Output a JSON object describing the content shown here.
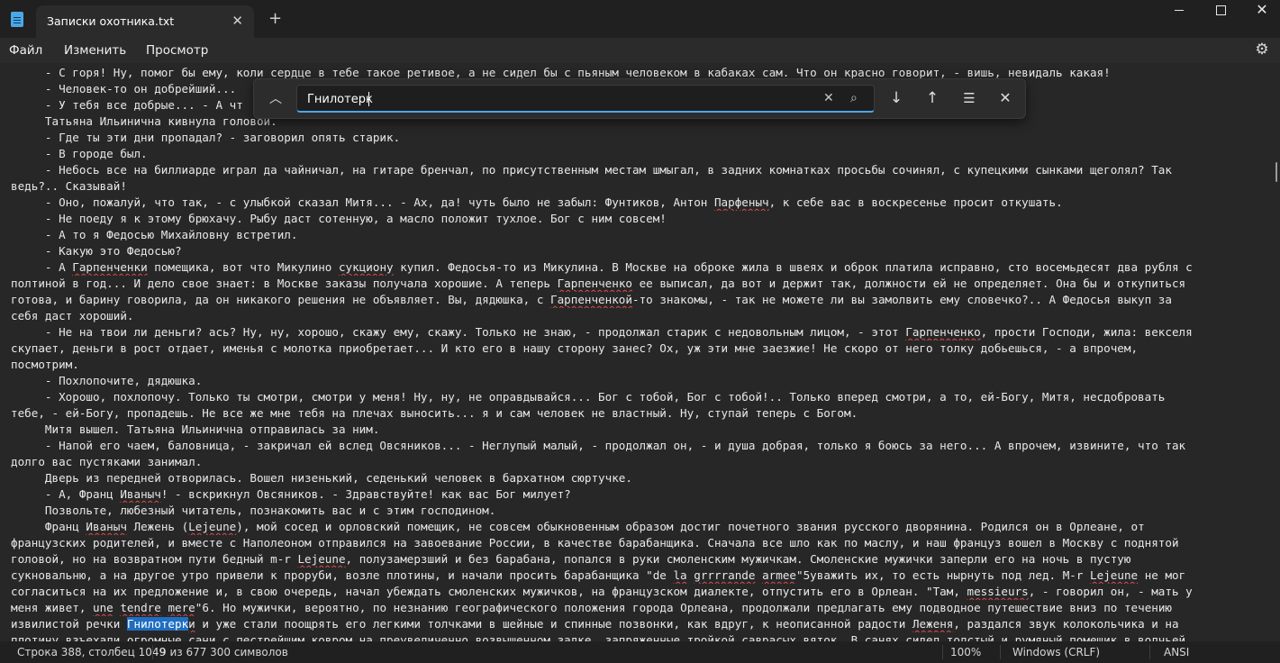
{
  "window": {
    "tab_title": "Записки охотника.txt",
    "tab_close_glyph": "✕",
    "new_tab_glyph": "+",
    "minimize_glyph": "",
    "maximize_glyph": "",
    "close_glyph": "✕"
  },
  "menu": {
    "file": "Файл",
    "edit": "Изменить",
    "view": "Просмотр",
    "settings_icon": "gear-icon"
  },
  "find": {
    "query": "Гнилотерк",
    "toggle_icon": "chevron-up-icon",
    "clear_icon": "close-icon",
    "search_icon": "search-icon",
    "next_icon": "arrow-down-icon",
    "prev_icon": "arrow-up-icon",
    "options_icon": "sliders-icon",
    "close_icon": "close-icon"
  },
  "editor": {
    "lines": [
      [
        {
          "t": "     - С горя! Ну, помог бы ему, коли сердце в тебе такое ретивое, а не сидел бы с пьяным человеком в кабаках сам. Что он красно говорит, - вишь, невидаль какая!"
        }
      ],
      [
        {
          "t": "     - Человек-то он добрейший..."
        }
      ],
      [
        {
          "t": "     - У тебя все добрые... - А чт"
        }
      ],
      [
        {
          "t": "     Татьяна Ильинична кивнула головой."
        }
      ],
      [
        {
          "t": "     - Где ты эти дни пропадал? - заговорил опять старик."
        }
      ],
      [
        {
          "t": "     - В городе был."
        }
      ],
      [
        {
          "t": "     - Небось все на биллиарде играл да чайничал, на гитаре бренчал, по присутственным местам шмыгал, в задних комнатках просьбы сочинял, с купецкими сынками щеголял? Так"
        }
      ],
      [
        {
          "t": "ведь?.. Сказывай!"
        }
      ],
      [
        {
          "t": "     - Оно, пожалуй, что так, - с улыбкой сказал Митя... - Ах, да! чуть было не забыл: Фунтиков, Антон "
        },
        {
          "t": "Парфеныч",
          "s": 1
        },
        {
          "t": ", к себе вас в воскресенье просит откушать."
        }
      ],
      [
        {
          "t": "     - Не поеду я к этому брюхачу. Рыбу даст сотенную, а масло положит тухлое. Бог с ним совсем!"
        }
      ],
      [
        {
          "t": "     - А то я Федосью Михайловну встретил."
        }
      ],
      [
        {
          "t": "     - Какую это Федосью?"
        }
      ],
      [
        {
          "t": "     - А "
        },
        {
          "t": "Гарпенченки",
          "s": 1
        },
        {
          "t": " помещика, вот что Микулино "
        },
        {
          "t": "сукциону",
          "s": 1
        },
        {
          "t": " купил. Федосья-то из Микулина. В Москве на оброке жила в швеях и оброк платила исправно, сто восемьдесят два рубля с"
        }
      ],
      [
        {
          "t": "полтиной в год... И дело свое знает: в Москве заказы получала хорошие. А теперь "
        },
        {
          "t": "Гарпенченко",
          "s": 1
        },
        {
          "t": " ее выписал, да вот и держит так, должности ей не определяет. Она бы и откупиться"
        }
      ],
      [
        {
          "t": "готова, и барину говорила, да он никакого решения не объявляет. Вы, дядюшка, с "
        },
        {
          "t": "Гарпенченкой",
          "s": 1
        },
        {
          "t": "-то знакомы, - так не можете ли вы замолвить ему словечко?.. А Федосья выкуп за"
        }
      ],
      [
        {
          "t": "себя даст хороший."
        }
      ],
      [
        {
          "t": "     - Не на твои ли деньги? ась? Ну, ну, хорошо, скажу ему, скажу. Только не знаю, - продолжал старик с недовольным лицом, - этот "
        },
        {
          "t": "Гарпенченко",
          "s": 1
        },
        {
          "t": ", прости Господи, жила: векселя"
        }
      ],
      [
        {
          "t": "скупает, деньги в рост отдает, именья с молотка приобретает... И кто его в нашу сторону занес? Ох, уж эти мне заезжие! Не скоро от него толку добьешься, - а впрочем,"
        }
      ],
      [
        {
          "t": "посмотрим."
        }
      ],
      [
        {
          "t": "     - Похлопочите, дядюшка."
        }
      ],
      [
        {
          "t": "     - Хорошо, похлопочу. Только ты смотри, смотри у меня! Ну, ну, не оправдывайся... Бог с тобой, Бог с тобой!.. Только вперед смотри, а то, ей-Богу, Митя, несдобровать"
        }
      ],
      [
        {
          "t": "тебе, - ей-Богу, пропадешь. Не все же мне тебя на плечах выносить... я и сам человек не властный. Ну, ступай теперь с Богом."
        }
      ],
      [
        {
          "t": "     Митя вышел. Татьяна Ильинична отправилась за ним."
        }
      ],
      [
        {
          "t": "     - Напой его чаем, баловница, - закричал ей вслед Овсяников... - Неглупый малый, - продолжал он, - и душа добрая, только я боюсь за него... А впрочем, извините, что так"
        }
      ],
      [
        {
          "t": "долго вас пустяками занимал."
        }
      ],
      [
        {
          "t": "     Дверь из передней отворилась. Вошел низенький, седенький человек в бархатном сюртучке."
        }
      ],
      [
        {
          "t": "     - А, Франц "
        },
        {
          "t": "Иваныч",
          "s": 1
        },
        {
          "t": "! - вскрикнул Овсяников. - Здравствуйте! как вас Бог милует?"
        }
      ],
      [
        {
          "t": "     Позвольте, любезный читатель, познакомить вас и с этим господином."
        }
      ],
      [
        {
          "t": "     Франц "
        },
        {
          "t": "Иваныч",
          "s": 1
        },
        {
          "t": " Лежень ("
        },
        {
          "t": "Lejeune",
          "s": 1
        },
        {
          "t": "), мой сосед и орловский помещик, не совсем обыкновенным образом достиг почетного звания русского дворянина. Родился он в Орлеане, от"
        }
      ],
      [
        {
          "t": "французских родителей, и вместе с Наполеоном отправился на завоевание России, в качестве барабанщика. Сначала все шло как по маслу, и наш француз вошел в Москву с поднятой"
        }
      ],
      [
        {
          "t": "головой, но на возвратном пути бедный m-r "
        },
        {
          "t": "Lejeune",
          "s": 1
        },
        {
          "t": ", полузамерзший и без барабана, попался в руки смоленским мужичкам. Смоленские мужички заперли его на ночь в пустую"
        }
      ],
      [
        {
          "t": "сукновальню, а на другое утро привели к проруби, возле плотины, и начали просить барабанщика \"de "
        },
        {
          "t": "la",
          "s": 1
        },
        {
          "t": " "
        },
        {
          "t": "grrrrande",
          "s": 1
        },
        {
          "t": " "
        },
        {
          "t": "armee",
          "s": 1
        },
        {
          "t": "\"5уважить их, то есть нырнуть под лед. M-r "
        },
        {
          "t": "Lejeune",
          "s": 1
        },
        {
          "t": " не мог"
        }
      ],
      [
        {
          "t": "согласиться на их предложение и, в свою очередь, начал убеждать смоленских мужичков, на французском диалекте, отпустить его в Орлеан. \"Там, "
        },
        {
          "t": "messieurs",
          "s": 1
        },
        {
          "t": ", - говорил он, - мать у"
        }
      ],
      [
        {
          "t": "меня живет, "
        },
        {
          "t": "une",
          "s": 1
        },
        {
          "t": " "
        },
        {
          "t": "tendre",
          "s": 1
        },
        {
          "t": " "
        },
        {
          "t": "mere",
          "s": 1
        },
        {
          "t": "\"6. Но мужички, вероятно, по незнанию географического положения города Орлеана, продолжали предлагать ему подводное путешествие вниз по течению"
        }
      ],
      [
        {
          "t": "извилистой речки "
        },
        {
          "t": "Гнилотерк",
          "h": 1
        },
        {
          "t": "и",
          "s": 1
        },
        {
          "t": " и уже стали поощрять его легкими толчками в шейные и спинные позвонки, как вдруг, к неописанной радости "
        },
        {
          "t": "Леженя",
          "s": 1
        },
        {
          "t": ", раздался звук колокольчика и на"
        }
      ],
      [
        {
          "t": "плотину взъехали огромные сани с пестрейшим ковром на преувеличенно возвышенном задке, запряженные тройкой саврасых вяток. В санях сидел толстый и румяный помещик в волчьей"
        }
      ]
    ]
  },
  "status": {
    "position": "Строка 388, столбец 1049",
    "char_count": "9 из 677 300 символов",
    "zoom": "100%",
    "line_ending": "Windows (CRLF)",
    "encoding": "ANSI"
  }
}
